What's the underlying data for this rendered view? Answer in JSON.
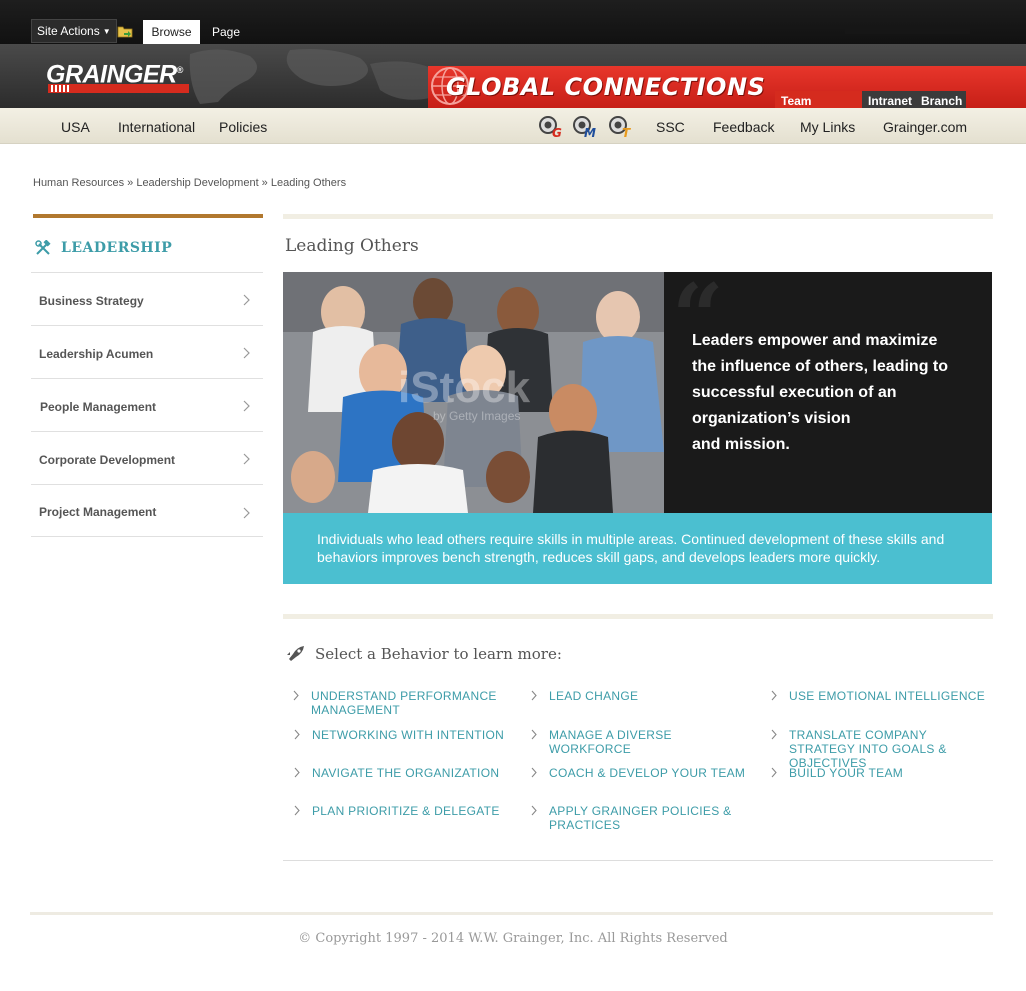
{
  "ribbon": {
    "site_actions": "Site Actions",
    "tab_browse": "Browse",
    "tab_page": "Page"
  },
  "brand": {
    "logo": "GRAINGER",
    "logo_reg": "®",
    "title": "GLOBAL CONNECTIONS",
    "tabs": [
      "Team Member",
      "Intranet",
      "Branch"
    ],
    "search_placeholder": ""
  },
  "nav": {
    "left": [
      "USA",
      "International",
      "Policies"
    ],
    "app_icons": [
      {
        "name": "app-g-icon",
        "letter": "G",
        "color": "#d52b1e"
      },
      {
        "name": "app-m-icon",
        "letter": "M",
        "color": "#1f4e9c"
      },
      {
        "name": "app-t-icon",
        "letter": "T",
        "color": "#e89a1c"
      }
    ],
    "right": [
      "SSC",
      "Feedback",
      "My Links",
      "Grainger.com"
    ]
  },
  "breadcrumb": "Human Resources » Leadership Development » Leading Others",
  "sidebar": {
    "heading": "LEADERSHIP",
    "items": [
      "Business Strategy",
      "Leadership Acumen",
      "People Management",
      "Corporate Development",
      "Project Management"
    ]
  },
  "main": {
    "title": "Leading Others",
    "quote": "Leaders empower and maximize\nthe influence of others, leading to\nsuccessful execution of an\norganization’s vision\nand mission.",
    "photo_watermark": "iStock",
    "photo_watermark_sub": "by Getty Images",
    "band_text": "Individuals who lead others require skills in multiple areas. Continued development of these skills and behaviors improves bench strength, reduces skill gaps, and develops leaders more quickly.",
    "select_label": "Select a Behavior to learn more:",
    "behaviors": {
      "col1": [
        "UNDERSTAND PERFORMANCE MANAGEMENT",
        "NETWORKING WITH INTENTION",
        "NAVIGATE THE ORGANIZATION",
        "PLAN PRIORITIZE & DELEGATE"
      ],
      "col2": [
        "LEAD CHANGE",
        "MANAGE A DIVERSE WORKFORCE",
        "COACH & DEVELOP YOUR TEAM",
        "APPLY GRAINGER POLICIES & PRACTICES"
      ],
      "col3": [
        "USE EMOTIONAL INTELLIGENCE",
        "TRANSLATE COMPANY STRATEGY INTO GOALS & OBJECTIVES",
        "BUILD YOUR TEAM"
      ]
    }
  },
  "footer": {
    "copyright": "© Copyright 1997 - 2014 W.W. Grainger, Inc. All Rights Reserved"
  },
  "colors": {
    "brand_red": "#d52b1e",
    "accent_teal": "#3d9ca8",
    "band_teal": "#4bbfd0",
    "sidebar_rule": "#b1782e"
  }
}
